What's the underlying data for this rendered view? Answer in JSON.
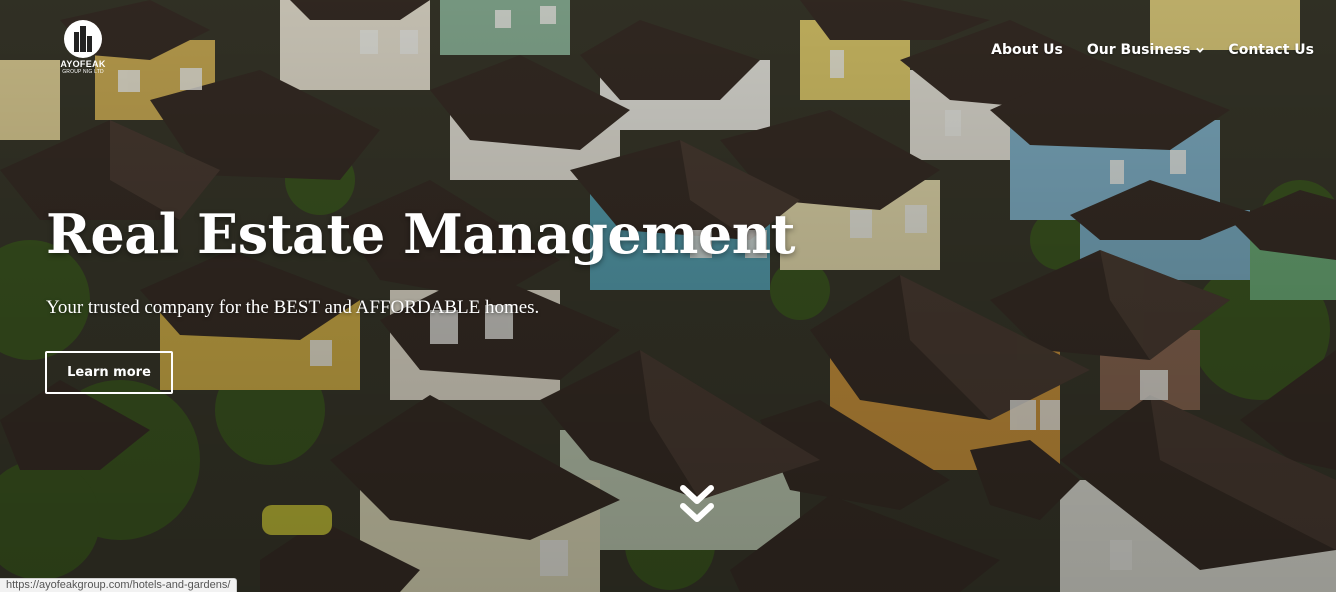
{
  "header": {
    "logo": {
      "name": "AYOFEAK",
      "tagline": "GROUP NIG LTD"
    },
    "nav": [
      {
        "label": "About Us",
        "has_dropdown": false
      },
      {
        "label": "Our Business",
        "has_dropdown": true
      },
      {
        "label": "Contact Us",
        "has_dropdown": false
      }
    ]
  },
  "hero": {
    "title": "Real Estate Management",
    "subtitle": "Your trusted company for the BEST and AFFORDABLE homes.",
    "cta_label": "Learn more",
    "scroll_icon": "double-chevron-down-icon"
  },
  "status_bar": {
    "url": "https://ayofeakgroup.com/hotels-and-gardens/"
  },
  "colors": {
    "text": "#ffffff",
    "roof_dark": "#3a2f27",
    "wall_cream": "#e9e2c8",
    "wall_blue": "#7fb3c9",
    "wall_yellow": "#c99a3a",
    "tree_green": "#3f5a22"
  }
}
